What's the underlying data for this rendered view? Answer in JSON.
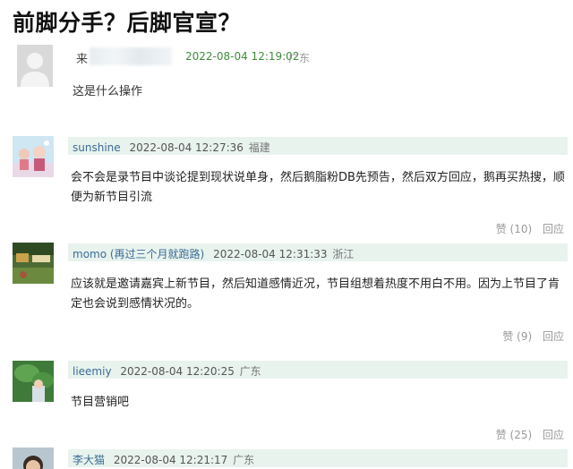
{
  "page": {
    "title": "前脚分手？后脚官宣？"
  },
  "op": {
    "prefix": "来",
    "time": "2022-08-04 12:19:02",
    "location": "广东",
    "body": "这是什么操作"
  },
  "comments": [
    {
      "user": "sunshine",
      "time": "2022-08-04 12:27:36",
      "location": "福建",
      "body": "会不会是录节目中谈论提到现状说单身，然后鹅脂粉DB先预告，然后双方回应，鹅再买热搜，顺便为新节目引流",
      "like": "赞 (10)",
      "reply": "回应"
    },
    {
      "user": "momo (再过三个月就跑路)",
      "time": "2022-08-04 12:31:33",
      "location": "浙江",
      "body": "应该就是邀请嘉宾上新节目，然后知道感情近况，节目组想着热度不用白不用。因为上节目了肯定也会说到感情状况的。",
      "like": "赞 (9)",
      "reply": "回应"
    },
    {
      "user": "lieemiy",
      "time": "2022-08-04 12:20:25",
      "location": "广东",
      "body": "节目营销吧",
      "like": "赞 (25)",
      "reply": "回应"
    },
    {
      "user": "李大猫",
      "time": "2022-08-04 12:21:17",
      "location": "广东"
    }
  ]
}
